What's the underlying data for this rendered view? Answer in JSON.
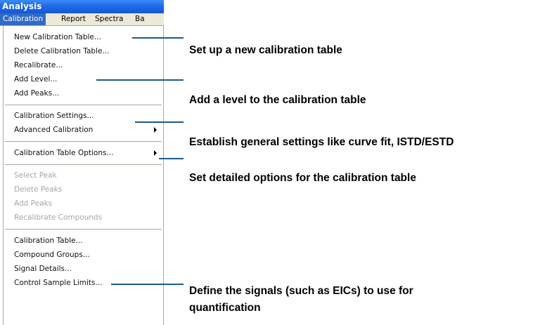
{
  "window": {
    "title": "Analysis"
  },
  "menubar": {
    "items": [
      {
        "label": "Calibration"
      },
      {
        "label": "Report"
      },
      {
        "label": "Spectra"
      },
      {
        "label": "Ba"
      }
    ]
  },
  "menu": {
    "items": [
      {
        "label": "New Calibration Table..."
      },
      {
        "label": "Delete Calibration Table..."
      },
      {
        "label": "Recalibrate..."
      },
      {
        "label": "Add Level..."
      },
      {
        "label": "Add Peaks..."
      },
      {
        "label": "Calibration Settings..."
      },
      {
        "label": "Advanced Calibration"
      },
      {
        "label": "Calibration Table Options..."
      },
      {
        "label": "Select Peak"
      },
      {
        "label": "Delete Peaks"
      },
      {
        "label": "Add Peaks"
      },
      {
        "label": "Recalibrate Compounds"
      },
      {
        "label": "Calibration Table..."
      },
      {
        "label": "Compound Groups..."
      },
      {
        "label": "Signal Details..."
      },
      {
        "label": "Control Sample Limits..."
      }
    ]
  },
  "annotations": [
    {
      "text": "Set up a new calibration table"
    },
    {
      "text": "Add a level to the calibration table"
    },
    {
      "text": "Establish general settings like curve fit, ISTD/ESTD"
    },
    {
      "text": "Set detailed options for the calibration table"
    },
    {
      "text": "Define the signals (such as EICs) to use for"
    },
    {
      "text": "quantification"
    }
  ]
}
